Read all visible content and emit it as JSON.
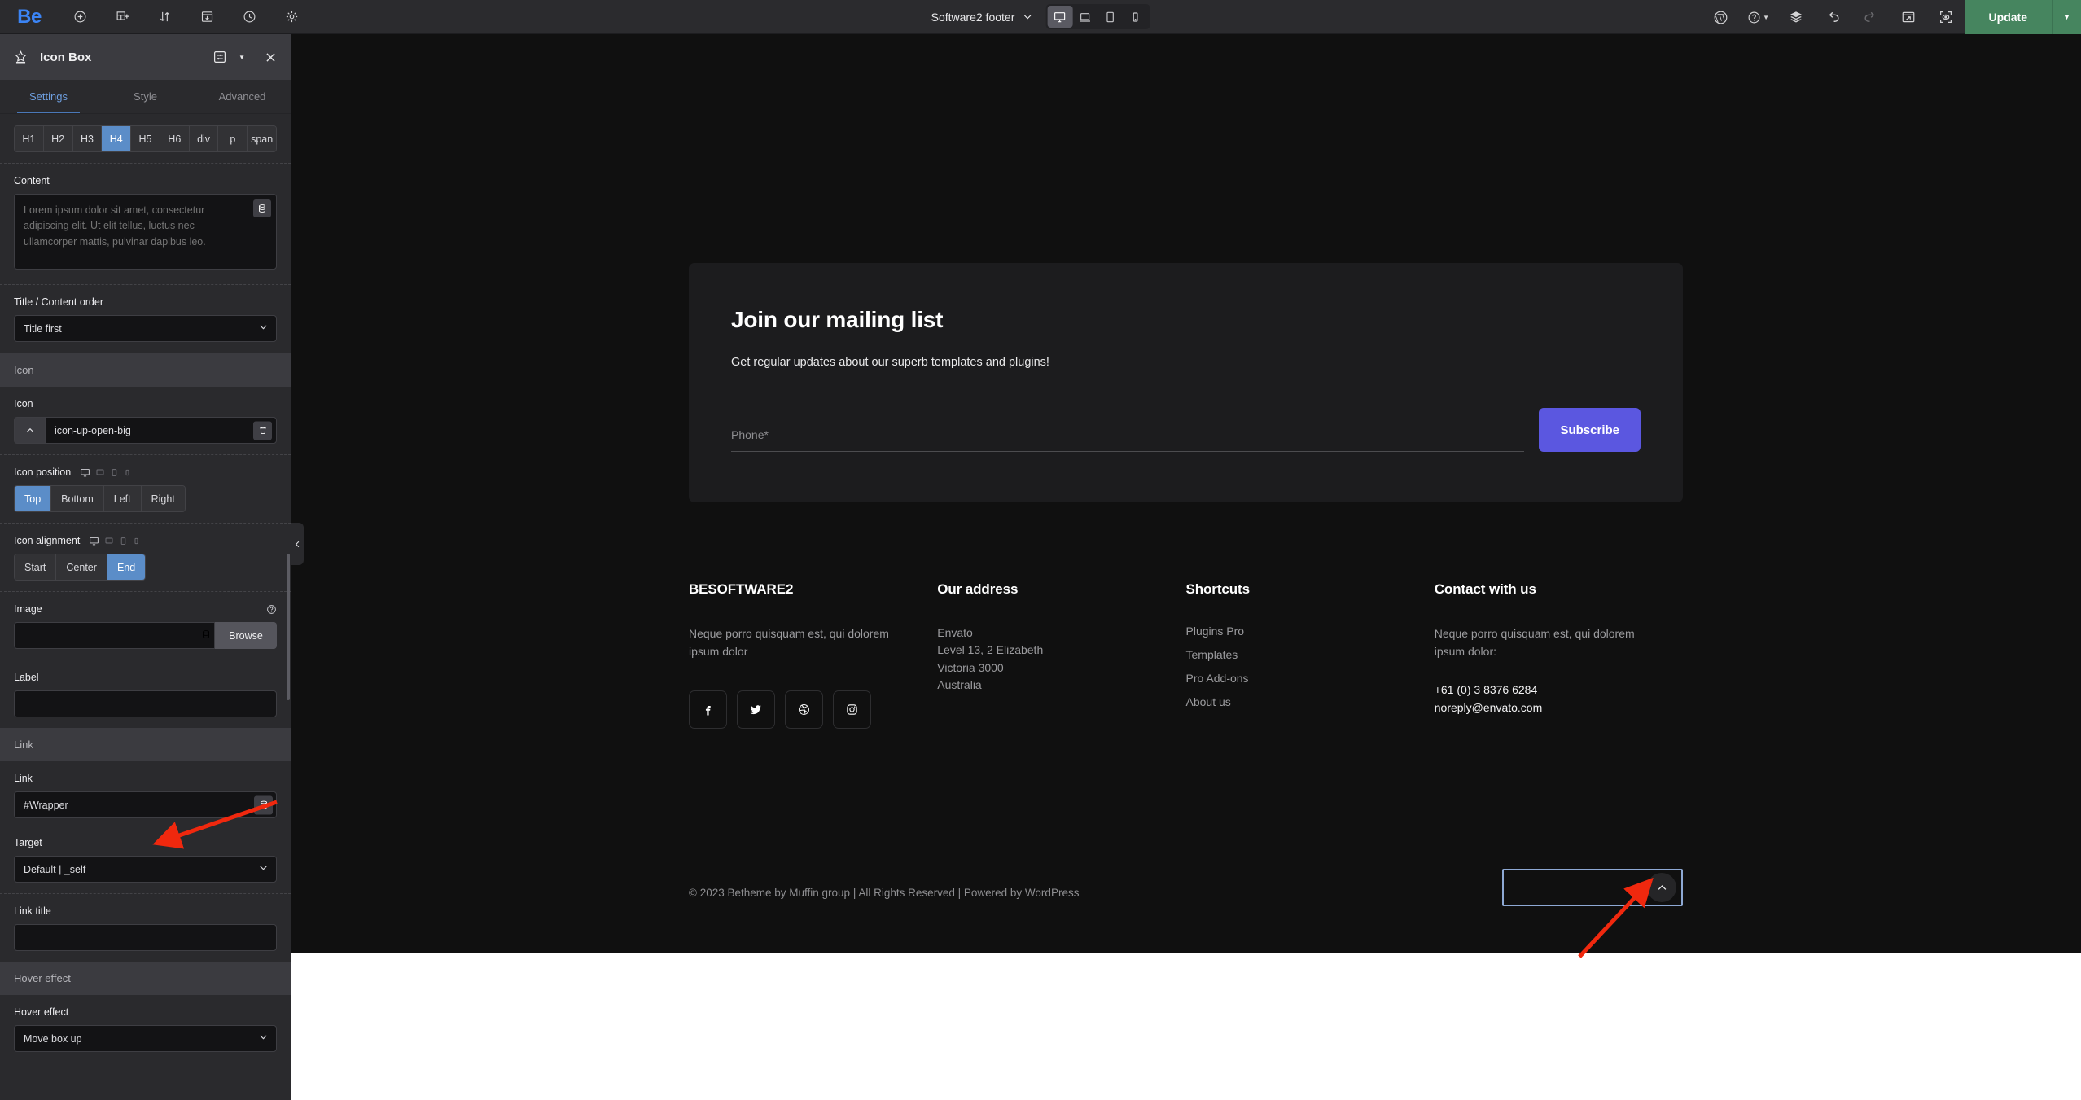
{
  "topbar": {
    "logo": "Be",
    "left_icons": [
      "add-circle-icon",
      "add-section-icon",
      "reorder-icon",
      "save-template-icon",
      "history-icon",
      "settings-gear-icon"
    ],
    "page_title": "Software2 footer",
    "devices": [
      {
        "name": "desktop",
        "active": true
      },
      {
        "name": "laptop",
        "active": false
      },
      {
        "name": "tablet",
        "active": false
      },
      {
        "name": "mobile",
        "active": false
      }
    ],
    "right_icons": [
      "wordpress-icon",
      "help-icon",
      "layers-icon",
      "undo-icon",
      "redo-icon",
      "preview-icon",
      "focus-mode-icon"
    ],
    "update_label": "Update"
  },
  "panel": {
    "title": "Icon Box",
    "tabs": [
      {
        "label": "Settings",
        "active": true
      },
      {
        "label": "Style",
        "active": false
      },
      {
        "label": "Advanced",
        "active": false
      }
    ],
    "tag_options": [
      "H1",
      "H2",
      "H3",
      "H4",
      "H5",
      "H6",
      "div",
      "p",
      "span"
    ],
    "tag_active": "H4",
    "content": {
      "label": "Content",
      "value": "",
      "placeholder": "Lorem ipsum dolor sit amet, consectetur adipiscing elit. Ut elit tellus, luctus nec ullamcorper mattis, pulvinar dapibus leo."
    },
    "title_content_order": {
      "label": "Title / Content order",
      "value": "Title first"
    },
    "icon_group_header": "Icon",
    "icon": {
      "label": "Icon",
      "value": "icon-up-open-big"
    },
    "icon_position": {
      "label": "Icon position",
      "options": [
        "Top",
        "Bottom",
        "Left",
        "Right"
      ],
      "active": "Top"
    },
    "icon_alignment": {
      "label": "Icon alignment",
      "options": [
        "Start",
        "Center",
        "End"
      ],
      "active": "End"
    },
    "image": {
      "label": "Image",
      "value": "",
      "browse_label": "Browse"
    },
    "label_field": {
      "label": "Label",
      "value": ""
    },
    "link_group_header": "Link",
    "link": {
      "label": "Link",
      "value": "#Wrapper"
    },
    "target": {
      "label": "Target",
      "value": "Default | _self"
    },
    "link_title": {
      "label": "Link title",
      "value": ""
    },
    "hover_group_header": "Hover effect",
    "hover_effect": {
      "label": "Hover effect",
      "value": "Move box up"
    }
  },
  "canvas": {
    "mailing": {
      "heading": "Join our mailing list",
      "subtext": "Get regular updates about our superb templates and plugins!",
      "phone_placeholder": "Phone*",
      "phone_value": "",
      "subscribe_label": "Subscribe"
    },
    "footer_columns": [
      {
        "heading": "BESOFTWARE2",
        "text": "Neque porro quisquam est, qui dolorem ipsum dolor",
        "socials": [
          "facebook-icon",
          "twitter-icon",
          "dribbble-icon",
          "instagram-icon"
        ]
      },
      {
        "heading": "Our address",
        "text": "Envato\nLevel 13, 2 Elizabeth\nVictoria 3000\nAustralia"
      },
      {
        "heading": "Shortcuts",
        "links": [
          "Plugins Pro",
          "Templates",
          "Pro Add-ons",
          "About us"
        ]
      },
      {
        "heading": "Contact with us",
        "text": "Neque porro quisquam est, qui dolorem ipsum dolor:",
        "strong": "+61 (0) 3 8376 6284\nnoreply@envato.com"
      }
    ],
    "copyright": "© 2023 Betheme by Muffin group | All Rights Reserved | Powered by WordPress",
    "scroll_top_icon": "chevron-up-icon"
  },
  "colors": {
    "accent_blue": "#5b8dc8",
    "logo_blue": "#3b84f5",
    "update_green": "#46855f",
    "subscribe_purple": "#5b57e0",
    "selection_outline": "#8ea9d4",
    "annotation_red": "#f0280e"
  }
}
